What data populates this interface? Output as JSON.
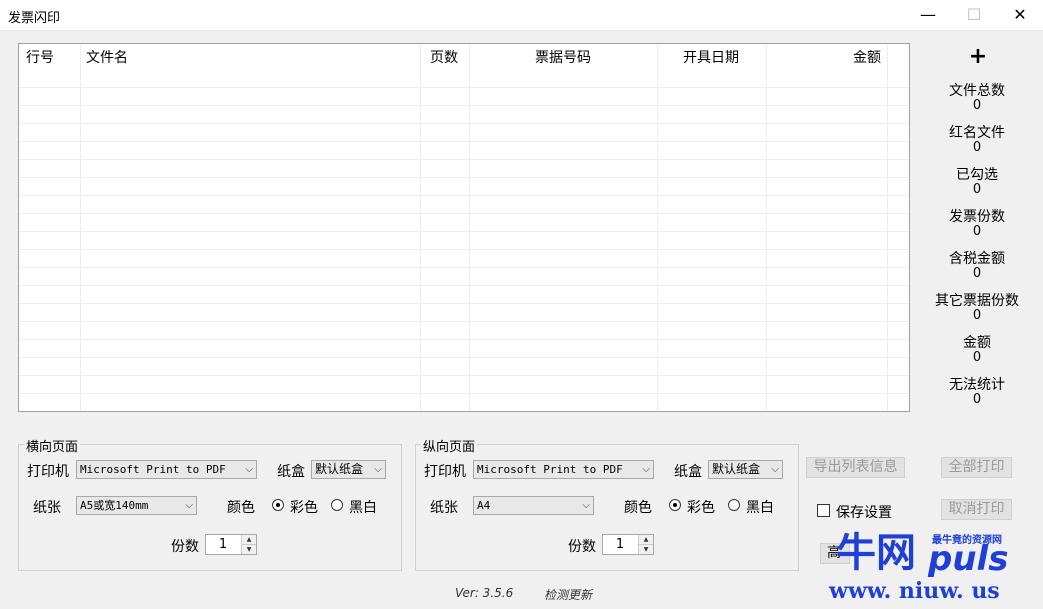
{
  "window": {
    "title": "发票闪印",
    "minimize": "—",
    "maximize": "☐",
    "close": "✕"
  },
  "table": {
    "columns": [
      "行号",
      "文件名",
      "页数",
      "票据号码",
      "开具日期",
      "金额"
    ]
  },
  "stats": {
    "add_symbol": "+",
    "items": [
      {
        "label": "文件总数",
        "value": "0"
      },
      {
        "label": "红名文件",
        "value": "0"
      },
      {
        "label": "已勾选",
        "value": "0"
      },
      {
        "label": "发票份数",
        "value": "0"
      },
      {
        "label": "含税金额",
        "value": "0"
      },
      {
        "label": "其它票据份数",
        "value": "0"
      },
      {
        "label": "金额",
        "value": "0"
      },
      {
        "label": "无法统计",
        "value": "0"
      }
    ]
  },
  "landscape": {
    "legend": "横向页面",
    "printer_label": "打印机",
    "printer_value": "Microsoft Print to PDF",
    "tray_label": "纸盒",
    "tray_value": "默认纸盒",
    "paper_label": "纸张",
    "paper_value": "A5或宽140mm",
    "color_label": "颜色",
    "color_opt": "彩色",
    "bw_opt": "黑白",
    "copies_label": "份数",
    "copies_value": "1",
    "selected_color": "彩色"
  },
  "portrait": {
    "legend": "纵向页面",
    "printer_label": "打印机",
    "printer_value": "Microsoft Print to PDF",
    "tray_label": "纸盒",
    "tray_value": "默认纸盒",
    "paper_label": "纸张",
    "paper_value": "A4",
    "color_label": "颜色",
    "color_opt": "彩色",
    "bw_opt": "黑白",
    "copies_label": "份数",
    "copies_value": "1",
    "selected_color": "彩色"
  },
  "actions": {
    "export_list": "导出列表信息",
    "print_all": "全部打印",
    "save_settings": "保存设置",
    "cancel_print": "取消打印",
    "advanced_partial": "高"
  },
  "footer": {
    "version": "Ver: 3.5.6",
    "check_update": "检测更新"
  },
  "watermark": {
    "text_big": "牛网",
    "text_puls": "puls",
    "tagline": "最牛竟的资源网",
    "url": "www. niuw. us"
  },
  "colors": {
    "watermark_blue": "#1f3fd6",
    "disabled_text": "#9a9a9a"
  }
}
